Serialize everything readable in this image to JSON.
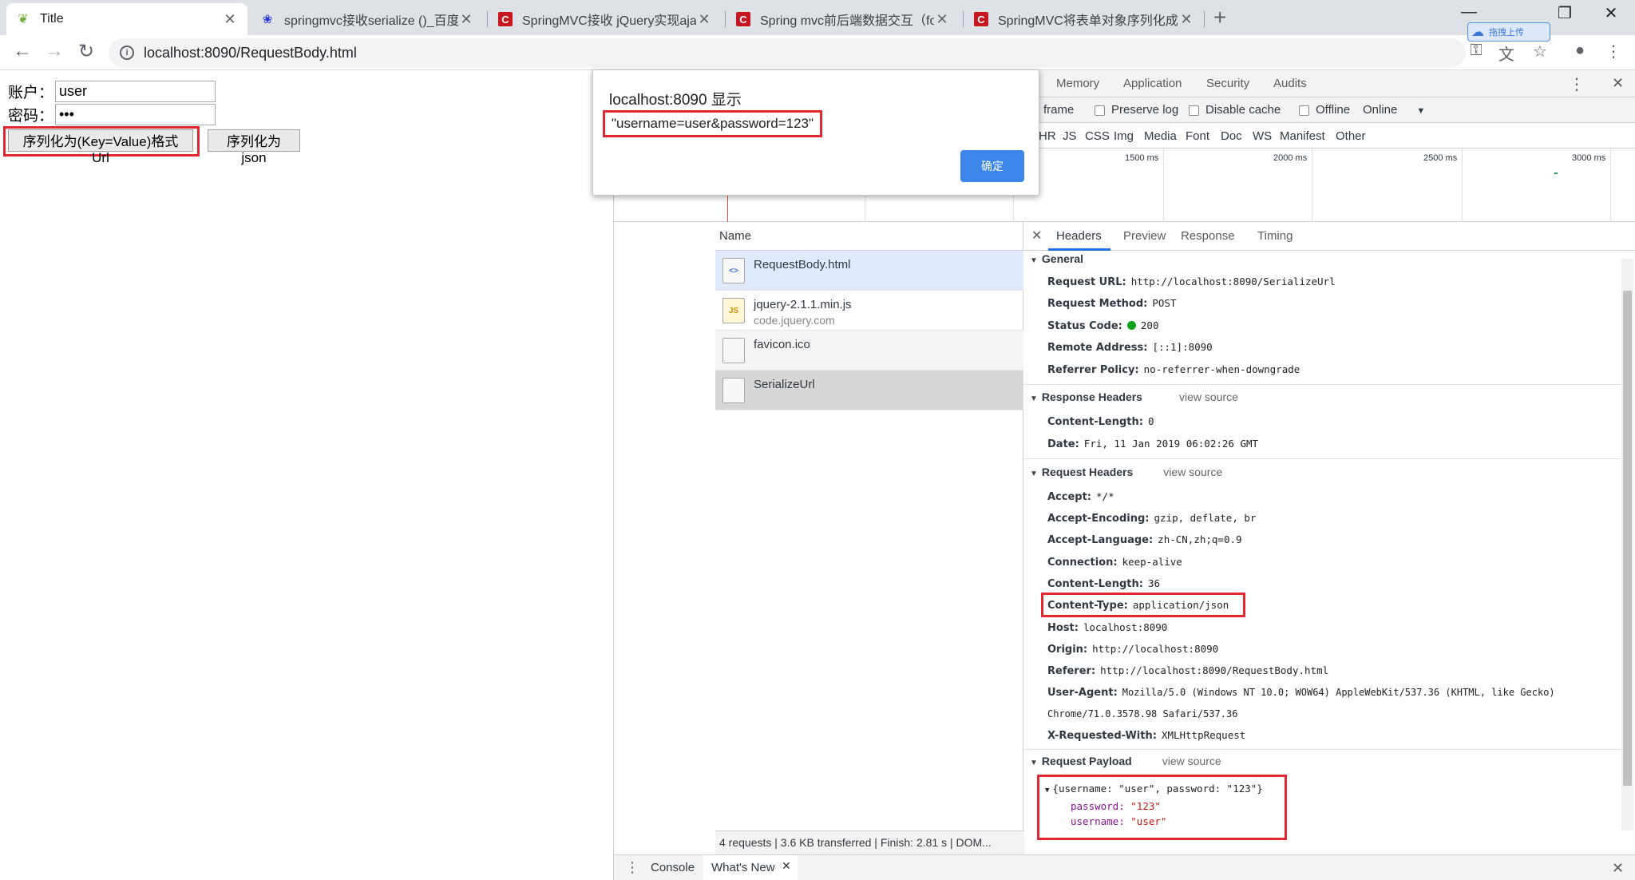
{
  "tabs": [
    {
      "title": "Title",
      "icon": "spring-leaf-icon",
      "active": true
    },
    {
      "title": "springmvc接收serialize ()_百度知道",
      "icon": "baidu-paw-icon"
    },
    {
      "title": "SpringMVC接收 jQuery实现ajax",
      "icon": "csdn-icon"
    },
    {
      "title": "Spring mvc前后端数据交互（fo",
      "icon": "csdn-icon"
    },
    {
      "title": "SpringMVC将表单对象序列化成",
      "icon": "csdn-icon"
    }
  ],
  "address": {
    "url": "localhost:8090/RequestBody.html"
  },
  "extension": {
    "label": "拖拽上传"
  },
  "page": {
    "account_label": "账户：",
    "account_value": "user",
    "password_label": "密码：",
    "password_value": "•••",
    "btn_serialize_url": "序列化为(Key=Value)格式Url",
    "btn_serialize_json": "序列化为json"
  },
  "alert": {
    "title": "localhost:8090 显示",
    "message": "\"username=user&password=123\"",
    "ok": "确定"
  },
  "devtools": {
    "tabs": [
      "Memory",
      "Application",
      "Security",
      "Audits"
    ],
    "filter": {
      "frame": "frame",
      "preserve_log": "Preserve log",
      "disable_cache": "Disable cache",
      "offline": "Offline",
      "online": "Online"
    },
    "types": [
      "HR",
      "JS",
      "CSS",
      "Img",
      "Media",
      "Font",
      "Doc",
      "WS",
      "Manifest",
      "Other"
    ],
    "timeline_labels": [
      "1500 ms",
      "2000 ms",
      "2500 ms",
      "3000 ms"
    ],
    "name_header": "Name",
    "requests": [
      {
        "name": "RequestBody.html",
        "sub": "",
        "icon": "html-file-icon"
      },
      {
        "name": "jquery-2.1.1.min.js",
        "sub": "code.jquery.com",
        "icon": "js-file-icon"
      },
      {
        "name": "favicon.ico",
        "sub": "",
        "icon": "file-icon"
      },
      {
        "name": "SerializeUrl",
        "sub": "",
        "icon": "file-icon"
      }
    ],
    "summary": "4 requests  |  3.6 KB transferred  |  Finish: 2.81 s  |  DOM...",
    "drawer": {
      "console": "Console",
      "whats_new": "What's New"
    },
    "detail_tabs": [
      "Headers",
      "Preview",
      "Response",
      "Timing"
    ],
    "general": {
      "title": "General",
      "rows": [
        {
          "k": "Request URL:",
          "v": "http://localhost:8090/SerializeUrl"
        },
        {
          "k": "Request Method:",
          "v": "POST"
        },
        {
          "k": "Status Code:",
          "v": "200"
        },
        {
          "k": "Remote Address:",
          "v": "[::1]:8090"
        },
        {
          "k": "Referrer Policy:",
          "v": "no-referrer-when-downgrade"
        }
      ]
    },
    "response_headers": {
      "title": "Response Headers",
      "view_source": "view source",
      "rows": [
        {
          "k": "Content-Length:",
          "v": "0"
        },
        {
          "k": "Date:",
          "v": "Fri, 11 Jan 2019 06:02:26 GMT"
        }
      ]
    },
    "request_headers": {
      "title": "Request Headers",
      "view_source": "view source",
      "rows": [
        {
          "k": "Accept:",
          "v": "*/*"
        },
        {
          "k": "Accept-Encoding:",
          "v": "gzip, deflate, br"
        },
        {
          "k": "Accept-Language:",
          "v": "zh-CN,zh;q=0.9"
        },
        {
          "k": "Connection:",
          "v": "keep-alive"
        },
        {
          "k": "Content-Length:",
          "v": "36"
        },
        {
          "k": "Content-Type:",
          "v": "application/json"
        },
        {
          "k": "Host:",
          "v": "localhost:8090"
        },
        {
          "k": "Origin:",
          "v": "http://localhost:8090"
        },
        {
          "k": "Referer:",
          "v": "http://localhost:8090/RequestBody.html"
        },
        {
          "k": "User-Agent:",
          "v": "Mozilla/5.0 (Windows NT 10.0; WOW64) AppleWebKit/537.36 (KHTML, like Gecko)"
        },
        {
          "k": "",
          "v": "Chrome/71.0.3578.98 Safari/537.36"
        },
        {
          "k": "X-Requested-With:",
          "v": "XMLHttpRequest"
        }
      ]
    },
    "payload": {
      "title": "Request Payload",
      "view_source": "view source",
      "summary": "{username: \"user\", password: \"123\"}",
      "password_key": "password:",
      "password_val": "\"123\"",
      "username_key": "username:",
      "username_val": "\"user\""
    }
  }
}
